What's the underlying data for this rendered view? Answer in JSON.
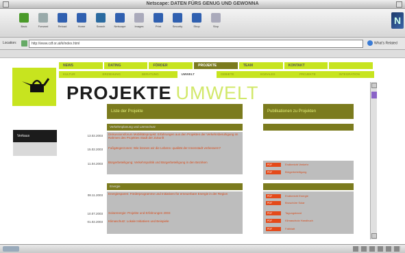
{
  "window": {
    "title": "Netscape: DATEN FÜRS GENUG UND GEWONNA"
  },
  "toolbar": {
    "buttons": [
      {
        "label": "Back",
        "icon": "back-arrow-icon",
        "color": "#4a9a2a"
      },
      {
        "label": "Forward",
        "icon": "forward-arrow-icon",
        "color": "#9aa"
      },
      {
        "label": "Reload",
        "icon": "reload-icon",
        "color": "#3060b0"
      },
      {
        "label": "Home",
        "icon": "home-icon",
        "color": "#3060b0"
      },
      {
        "label": "Search",
        "icon": "search-icon",
        "color": "#2a6aa0"
      },
      {
        "label": "Netscape",
        "icon": "netscape-icon",
        "color": "#3060b0"
      },
      {
        "label": "Images",
        "icon": "images-icon",
        "color": "#aab"
      },
      {
        "label": "Print",
        "icon": "print-icon",
        "color": "#3060b0"
      },
      {
        "label": "Security",
        "icon": "lock-icon",
        "color": "#3060b0"
      },
      {
        "label": "Shop",
        "icon": "shop-icon",
        "color": "#3060b0"
      },
      {
        "label": "Stop",
        "icon": "stop-icon",
        "color": "#aab"
      }
    ]
  },
  "location": {
    "label": "Location:",
    "url": "http://www.cdf.or.at/k/index.html",
    "related": "What's Related"
  },
  "nav_main": [
    "NEWS",
    "DATING",
    "FÖRDER",
    "PROJEKTE",
    "TEAM",
    "KONTAKT",
    ""
  ],
  "nav_sub": [
    "KULTUR",
    "ERZIEHUNG",
    "BERATUNG",
    "UMWELT",
    "GEBIETE",
    "SOZIALES",
    "PROJEKTE",
    "INTEGRATION"
  ],
  "page": {
    "title_part1": "PROJEKTE",
    "title_part2": "UMWELT",
    "sidebar_label": "Verkaus"
  },
  "columns": {
    "left_header": "Liste der Projekte",
    "right_header": "Publikationen zu Projekten"
  },
  "section1": {
    "header": "Verkehrsplanung und Lärmschutz",
    "entries": [
      {
        "date": "13.02.2003",
        "text": "Diskussionsforum Mobilitätsprojekt: Erfahrungen aus den Projekten der Verkehrsberuhigung im Rahmen des Projektes Stadt der Zukunft"
      },
      {
        "date": "15.02.2003",
        "text": "Fußgängerzonen: Wie können wir die Lebens- qualität der Innenstadt verbessern?"
      },
      {
        "date": "11.04.2003",
        "text": "Bürgerbeteiligung: Verkehrspolitik und Bürgerbeteiligung in den Bezirken"
      }
    ],
    "publications": [
      {
        "tag": "PDF",
        "text": "Endbericht Verkehr"
      },
      {
        "tag": "PDF",
        "text": "Bürgerbeteiligung"
      }
    ]
  },
  "section2": {
    "header": "Energie",
    "entries": [
      {
        "date": "08.11.2003",
        "text": "Energiesparen: Förderprogramme und Initiativen für erneuerbare Energie in der Region"
      },
      {
        "date": "10.07.2003",
        "text": "Solarenergie: Projekte und Erfahrungen 2003"
      },
      {
        "date": "01.02.2003",
        "text": "Klimaschutz: Lokale Initiativen und Beispiele"
      }
    ],
    "publications": [
      {
        "tag": "PDF",
        "text": "Endbericht Energie"
      },
      {
        "tag": "PDF",
        "text": "Broschüre Solar"
      },
      {
        "tag": "PDF",
        "text": "Tagungsband"
      },
      {
        "tag": "PDF",
        "text": "Klimaschutz Handbuch"
      },
      {
        "tag": "PDF",
        "text": "Faltblatt"
      }
    ]
  },
  "colors": {
    "lime": "#c7e41f",
    "olive": "#7b7b1e",
    "orange": "#e44a1a"
  }
}
